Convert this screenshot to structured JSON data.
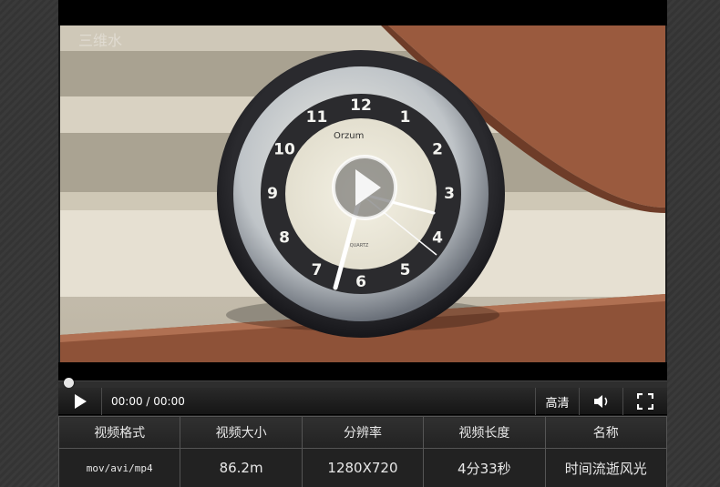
{
  "player": {
    "time_display": "00:00 / 00:00",
    "quality_label": "高清",
    "progress_fraction": 0.0,
    "icons": {
      "play": "play-icon",
      "volume": "volume-icon",
      "fullscreen": "fullscreen-icon",
      "big_play": "play-overlay-icon"
    },
    "watermark": "三维水",
    "clock_brand": "Orzum",
    "clock_sub": "QUARTZ",
    "clock_numbers": [
      "12",
      "1",
      "2",
      "3",
      "4",
      "5",
      "6",
      "7",
      "8",
      "9",
      "10",
      "11"
    ]
  },
  "info_table": {
    "headers": [
      "视频格式",
      "视频大小",
      "分辨率",
      "视频长度",
      "名称"
    ],
    "values": [
      "mov/avi/mp4",
      "86.2m",
      "1280X720",
      "4分33秒",
      "时间流逝风光"
    ]
  },
  "colors": {
    "panel_bg": "#1c1c1c",
    "text": "#e8e8e8",
    "border": "#555555"
  }
}
